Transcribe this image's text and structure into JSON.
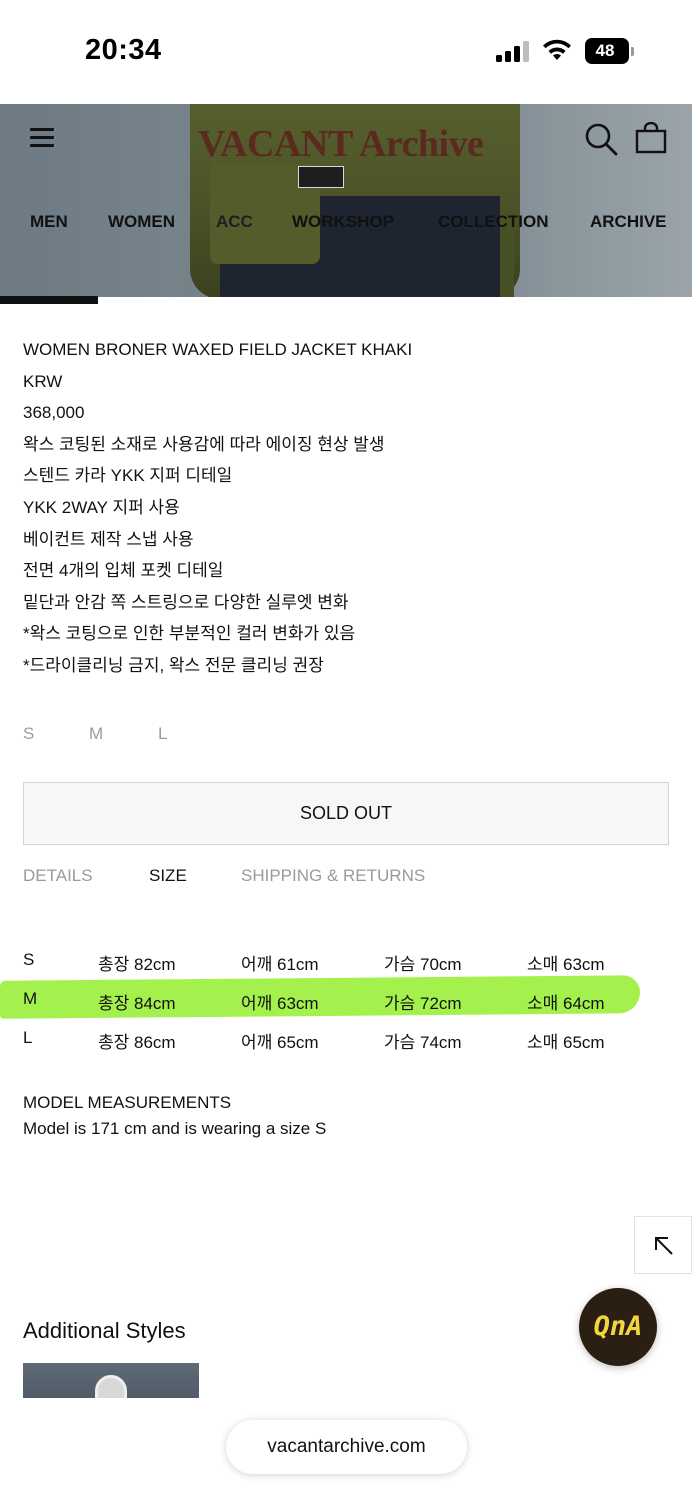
{
  "status_bar": {
    "time": "20:34",
    "battery": "48"
  },
  "header": {
    "logo": "VACANT Archive",
    "nav": [
      "MEN",
      "WOMEN",
      "ACC",
      "WORKSHOP",
      "COLLECTION",
      "ARCHIVE"
    ]
  },
  "product": {
    "name": "WOMEN BRONER WAXED FIELD JACKET KHAKI",
    "currency": "KRW",
    "price": "368,000",
    "description": [
      "왁스 코팅된 소재로 사용감에 따라 에이징 현상 발생",
      "스텐드 카라 YKK 지퍼 디테일",
      "YKK 2WAY 지퍼 사용",
      "베이컨트 제작 스냅 사용",
      "전면 4개의 입체 포켓 디테일",
      "밑단과 안감 쪽 스트링으로 다양한 실루엣 변화",
      "*왁스 코팅으로 인한 부분적인 컬러 변화가 있음",
      "*드라이클리닝 금지, 왁스 전문 클리닝 권장"
    ],
    "size_options": [
      "S",
      "M",
      "L"
    ],
    "sold_out_label": "SOLD OUT"
  },
  "tabs": {
    "details": "DETAILS",
    "size": "SIZE",
    "shipping": "SHIPPING & RETURNS",
    "active": "SIZE"
  },
  "size_table": [
    {
      "size": "S",
      "length": "총장 82cm",
      "shoulder": "어깨 61cm",
      "chest": "가슴 70cm",
      "sleeve": "소매 63cm"
    },
    {
      "size": "M",
      "length": "총장 84cm",
      "shoulder": "어깨 63cm",
      "chest": "가슴 72cm",
      "sleeve": "소매 64cm"
    },
    {
      "size": "L",
      "length": "총장 86cm",
      "shoulder": "어깨 65cm",
      "chest": "가슴 74cm",
      "sleeve": "소매 65cm"
    }
  ],
  "highlight_color": "#9af03a",
  "model": {
    "title": "MODEL MEASUREMENTS",
    "text": "Model is 171 cm and is wearing a size S"
  },
  "additional_title": "Additional Styles",
  "qna_label": "QnA",
  "url": "vacantarchive.com"
}
